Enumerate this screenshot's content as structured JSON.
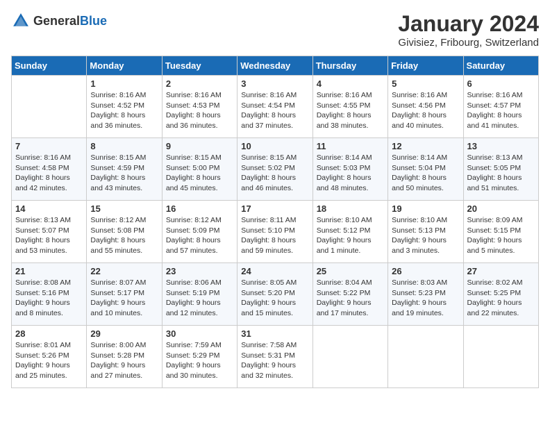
{
  "header": {
    "logo_general": "General",
    "logo_blue": "Blue",
    "month_title": "January 2024",
    "subtitle": "Givisiez, Fribourg, Switzerland"
  },
  "weekdays": [
    "Sunday",
    "Monday",
    "Tuesday",
    "Wednesday",
    "Thursday",
    "Friday",
    "Saturday"
  ],
  "weeks": [
    [
      {
        "day": "",
        "sunrise": "",
        "sunset": "",
        "daylight": ""
      },
      {
        "day": "1",
        "sunrise": "Sunrise: 8:16 AM",
        "sunset": "Sunset: 4:52 PM",
        "daylight": "Daylight: 8 hours and 36 minutes."
      },
      {
        "day": "2",
        "sunrise": "Sunrise: 8:16 AM",
        "sunset": "Sunset: 4:53 PM",
        "daylight": "Daylight: 8 hours and 36 minutes."
      },
      {
        "day": "3",
        "sunrise": "Sunrise: 8:16 AM",
        "sunset": "Sunset: 4:54 PM",
        "daylight": "Daylight: 8 hours and 37 minutes."
      },
      {
        "day": "4",
        "sunrise": "Sunrise: 8:16 AM",
        "sunset": "Sunset: 4:55 PM",
        "daylight": "Daylight: 8 hours and 38 minutes."
      },
      {
        "day": "5",
        "sunrise": "Sunrise: 8:16 AM",
        "sunset": "Sunset: 4:56 PM",
        "daylight": "Daylight: 8 hours and 40 minutes."
      },
      {
        "day": "6",
        "sunrise": "Sunrise: 8:16 AM",
        "sunset": "Sunset: 4:57 PM",
        "daylight": "Daylight: 8 hours and 41 minutes."
      }
    ],
    [
      {
        "day": "7",
        "sunrise": "Sunrise: 8:16 AM",
        "sunset": "Sunset: 4:58 PM",
        "daylight": "Daylight: 8 hours and 42 minutes."
      },
      {
        "day": "8",
        "sunrise": "Sunrise: 8:15 AM",
        "sunset": "Sunset: 4:59 PM",
        "daylight": "Daylight: 8 hours and 43 minutes."
      },
      {
        "day": "9",
        "sunrise": "Sunrise: 8:15 AM",
        "sunset": "Sunset: 5:00 PM",
        "daylight": "Daylight: 8 hours and 45 minutes."
      },
      {
        "day": "10",
        "sunrise": "Sunrise: 8:15 AM",
        "sunset": "Sunset: 5:02 PM",
        "daylight": "Daylight: 8 hours and 46 minutes."
      },
      {
        "day": "11",
        "sunrise": "Sunrise: 8:14 AM",
        "sunset": "Sunset: 5:03 PM",
        "daylight": "Daylight: 8 hours and 48 minutes."
      },
      {
        "day": "12",
        "sunrise": "Sunrise: 8:14 AM",
        "sunset": "Sunset: 5:04 PM",
        "daylight": "Daylight: 8 hours and 50 minutes."
      },
      {
        "day": "13",
        "sunrise": "Sunrise: 8:13 AM",
        "sunset": "Sunset: 5:05 PM",
        "daylight": "Daylight: 8 hours and 51 minutes."
      }
    ],
    [
      {
        "day": "14",
        "sunrise": "Sunrise: 8:13 AM",
        "sunset": "Sunset: 5:07 PM",
        "daylight": "Daylight: 8 hours and 53 minutes."
      },
      {
        "day": "15",
        "sunrise": "Sunrise: 8:12 AM",
        "sunset": "Sunset: 5:08 PM",
        "daylight": "Daylight: 8 hours and 55 minutes."
      },
      {
        "day": "16",
        "sunrise": "Sunrise: 8:12 AM",
        "sunset": "Sunset: 5:09 PM",
        "daylight": "Daylight: 8 hours and 57 minutes."
      },
      {
        "day": "17",
        "sunrise": "Sunrise: 8:11 AM",
        "sunset": "Sunset: 5:10 PM",
        "daylight": "Daylight: 8 hours and 59 minutes."
      },
      {
        "day": "18",
        "sunrise": "Sunrise: 8:10 AM",
        "sunset": "Sunset: 5:12 PM",
        "daylight": "Daylight: 9 hours and 1 minute."
      },
      {
        "day": "19",
        "sunrise": "Sunrise: 8:10 AM",
        "sunset": "Sunset: 5:13 PM",
        "daylight": "Daylight: 9 hours and 3 minutes."
      },
      {
        "day": "20",
        "sunrise": "Sunrise: 8:09 AM",
        "sunset": "Sunset: 5:15 PM",
        "daylight": "Daylight: 9 hours and 5 minutes."
      }
    ],
    [
      {
        "day": "21",
        "sunrise": "Sunrise: 8:08 AM",
        "sunset": "Sunset: 5:16 PM",
        "daylight": "Daylight: 9 hours and 8 minutes."
      },
      {
        "day": "22",
        "sunrise": "Sunrise: 8:07 AM",
        "sunset": "Sunset: 5:17 PM",
        "daylight": "Daylight: 9 hours and 10 minutes."
      },
      {
        "day": "23",
        "sunrise": "Sunrise: 8:06 AM",
        "sunset": "Sunset: 5:19 PM",
        "daylight": "Daylight: 9 hours and 12 minutes."
      },
      {
        "day": "24",
        "sunrise": "Sunrise: 8:05 AM",
        "sunset": "Sunset: 5:20 PM",
        "daylight": "Daylight: 9 hours and 15 minutes."
      },
      {
        "day": "25",
        "sunrise": "Sunrise: 8:04 AM",
        "sunset": "Sunset: 5:22 PM",
        "daylight": "Daylight: 9 hours and 17 minutes."
      },
      {
        "day": "26",
        "sunrise": "Sunrise: 8:03 AM",
        "sunset": "Sunset: 5:23 PM",
        "daylight": "Daylight: 9 hours and 19 minutes."
      },
      {
        "day": "27",
        "sunrise": "Sunrise: 8:02 AM",
        "sunset": "Sunset: 5:25 PM",
        "daylight": "Daylight: 9 hours and 22 minutes."
      }
    ],
    [
      {
        "day": "28",
        "sunrise": "Sunrise: 8:01 AM",
        "sunset": "Sunset: 5:26 PM",
        "daylight": "Daylight: 9 hours and 25 minutes."
      },
      {
        "day": "29",
        "sunrise": "Sunrise: 8:00 AM",
        "sunset": "Sunset: 5:28 PM",
        "daylight": "Daylight: 9 hours and 27 minutes."
      },
      {
        "day": "30",
        "sunrise": "Sunrise: 7:59 AM",
        "sunset": "Sunset: 5:29 PM",
        "daylight": "Daylight: 9 hours and 30 minutes."
      },
      {
        "day": "31",
        "sunrise": "Sunrise: 7:58 AM",
        "sunset": "Sunset: 5:31 PM",
        "daylight": "Daylight: 9 hours and 32 minutes."
      },
      {
        "day": "",
        "sunrise": "",
        "sunset": "",
        "daylight": ""
      },
      {
        "day": "",
        "sunrise": "",
        "sunset": "",
        "daylight": ""
      },
      {
        "day": "",
        "sunrise": "",
        "sunset": "",
        "daylight": ""
      }
    ]
  ]
}
